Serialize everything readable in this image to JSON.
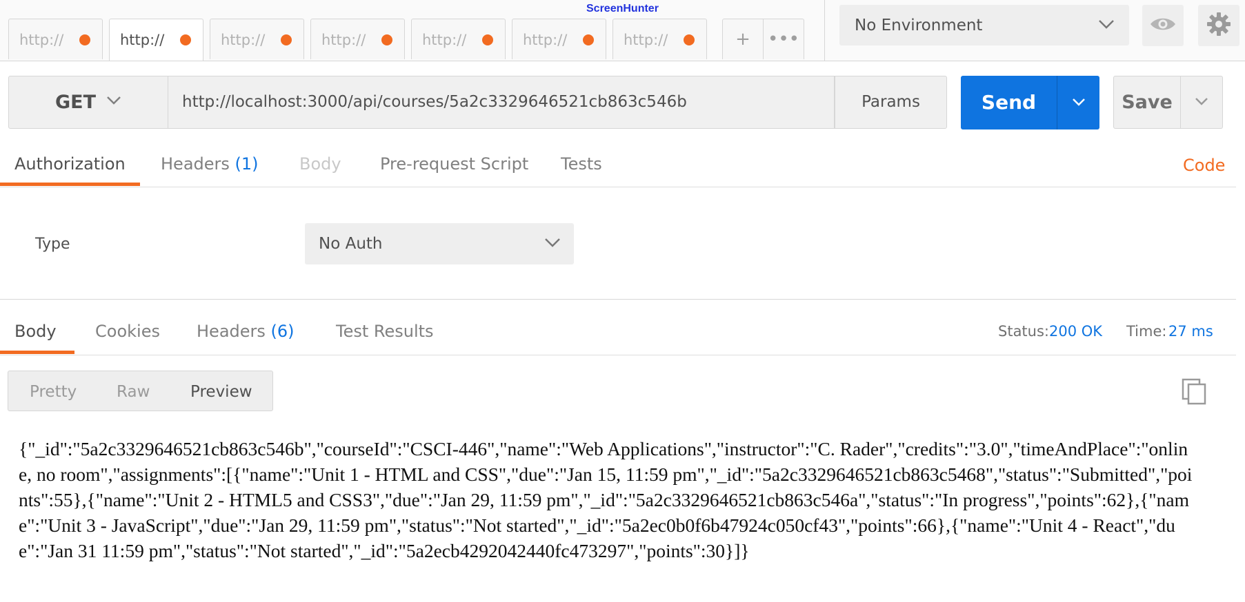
{
  "tabs": [
    {
      "label": "http://",
      "active": false
    },
    {
      "label": "http://",
      "active": true
    },
    {
      "label": "http://",
      "active": false
    },
    {
      "label": "http://",
      "active": false
    },
    {
      "label": "http://",
      "active": false
    },
    {
      "label": "http://",
      "active": false
    },
    {
      "label": "http://",
      "active": false
    }
  ],
  "tab_actions": {
    "add": "+",
    "more": "•••"
  },
  "overlay_text": "ScreenHunter",
  "environment": {
    "selected": "No Environment"
  },
  "icons": {
    "env_chevron": "chevron-down-icon",
    "eye": "eye-icon",
    "gear": "gear-icon",
    "copy": "copy-icon",
    "dot": "unsaved-dot-icon"
  },
  "request": {
    "method": "GET",
    "url": "http://localhost:3000/api/courses/5a2c3329646521cb863c546b",
    "params_label": "Params",
    "send_label": "Send",
    "save_label": "Save"
  },
  "request_tabs": {
    "authorization": "Authorization",
    "headers": "Headers",
    "headers_count": "(1)",
    "body": "Body",
    "prerequest": "Pre-request Script",
    "tests": "Tests",
    "code": "Code"
  },
  "auth": {
    "type_label": "Type",
    "selected": "No Auth"
  },
  "response_tabs": {
    "body": "Body",
    "cookies": "Cookies",
    "headers": "Headers",
    "headers_count": "(6)",
    "test_results": "Test Results"
  },
  "response_meta": {
    "status_label": "Status:",
    "status_value": "200 OK",
    "time_label": "Time:",
    "time_value": "27 ms"
  },
  "view_modes": {
    "pretty": "Pretty",
    "raw": "Raw",
    "preview": "Preview",
    "selected": "Preview"
  },
  "response_body": "{\"_id\":\"5a2c3329646521cb863c546b\",\"courseId\":\"CSCI-446\",\"name\":\"Web Applications\",\"instructor\":\"C. Rader\",\"credits\":\"3.0\",\"timeAndPlace\":\"online, no room\",\"assignments\":[{\"name\":\"Unit 1 - HTML and CSS\",\"due\":\"Jan 15, 11:59 pm\",\"_id\":\"5a2c3329646521cb863c5468\",\"status\":\"Submitted\",\"points\":55},{\"name\":\"Unit 2 - HTML5 and CSS3\",\"due\":\"Jan 29, 11:59 pm\",\"_id\":\"5a2c3329646521cb863c546a\",\"status\":\"In progress\",\"points\":62},{\"name\":\"Unit 3 - JavaScript\",\"due\":\"Jan 29, 11:59 pm\",\"status\":\"Not started\",\"_id\":\"5a2ec0b0f6b47924c050cf43\",\"points\":66},{\"name\":\"Unit 4 - React\",\"due\":\"Jan 31 11:59 pm\",\"status\":\"Not started\",\"_id\":\"5a2ecb4292042440fc473297\",\"points\":30}]}",
  "colors": {
    "accent": "#f26b21",
    "primary": "#0f74e0",
    "link": "#0f74e0"
  }
}
